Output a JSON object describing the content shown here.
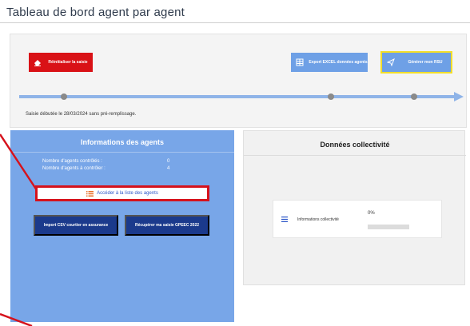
{
  "page": {
    "title": "Tableau de bord agent par agent"
  },
  "actions": {
    "reinit": "Réinitialiser la saisie",
    "export": "Export EXCEL données agents",
    "generate": "Générer mon RSU"
  },
  "timeline": {
    "status": "Saisie débutée le 28/03/2024 sans pré-remplissage."
  },
  "agents": {
    "title": "Informations des agents",
    "stats": [
      {
        "label": "Nombre d'agents contrôlés :",
        "value": "0"
      },
      {
        "label": "Nombre d'agents à contrôler :",
        "value": "4"
      }
    ],
    "list_button": "Accéder à la liste des agents",
    "import_button": "Import CSV courtier en assurance",
    "recover_button": "Récupérer ma saisie GPEEC 2022"
  },
  "collectivite": {
    "title": "Données collectivité",
    "item_label": "Informations collectivité",
    "progress_text": "0%",
    "progress_fraction": 0.0
  },
  "colors": {
    "red": "#d91116",
    "blue": "#6ea0e6",
    "navy": "#1b3a8c",
    "yellow_border": "#f2de2a",
    "highlight": "#d6121c"
  }
}
